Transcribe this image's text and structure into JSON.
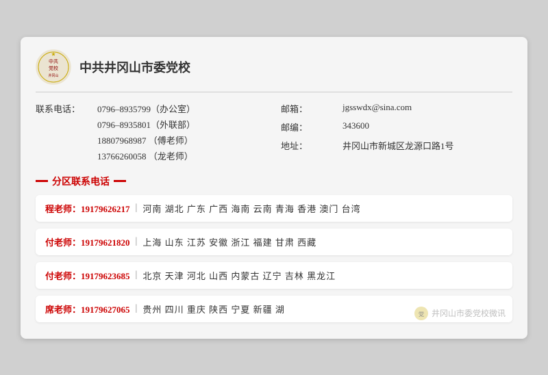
{
  "header": {
    "org_name": "中共井冈山市委党校"
  },
  "contact": {
    "phone_label": "联系电话：",
    "phone1": "0796–8935799（办公室）",
    "phone2": "0796–8935801（外联部）",
    "phone3": "18807968987 （傅老师）",
    "phone4": "13766260058 （龙老师）",
    "email_label": "邮箱：",
    "email": "jgsswdx@sina.com",
    "postcode_label": "邮编：",
    "postcode": "343600",
    "address_label": "地址：",
    "address": "井冈山市新城区龙源口路1号"
  },
  "section_title": "分区联系电话",
  "regions": [
    {
      "teacher": "程老师：",
      "phone": "19179626217",
      "areas": "河南  湖北  广东  广西  海南  云南  青海  香港  澳门  台湾"
    },
    {
      "teacher": "付老师：",
      "phone": "19179621820",
      "areas": "上海  山东  江苏  安徽  浙江  福建  甘肃  西藏"
    },
    {
      "teacher": "付老师：",
      "phone": "19179623685",
      "areas": "北京  天津  河北  山西  内蒙古  辽宁  吉林  黑龙江"
    },
    {
      "teacher": "席老师：",
      "phone": "19179627065",
      "areas": "贵州  四川  重庆  陕西  宁夏  新疆  湖..."
    }
  ],
  "watermark": "井冈山市委党校微讯"
}
